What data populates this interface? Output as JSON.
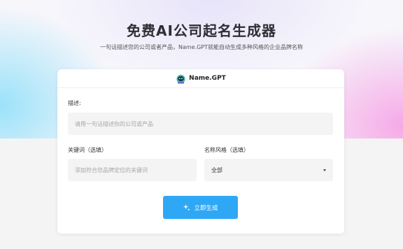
{
  "hero": {
    "title": "免费AI公司起名生成器",
    "subtitle": "一句话描述您的公司或者产品，Name.GPT就能自动生成多种风格的企业品牌名称"
  },
  "card": {
    "brand": "Name.GPT",
    "logo_icon": "robot-logo-icon",
    "description": {
      "label": "描述:",
      "placeholder": "请用一句话描述你的公司或产品",
      "value": ""
    },
    "keywords": {
      "label": "关键词（选填）",
      "placeholder": "添加符合您品牌定位的关键词",
      "value": ""
    },
    "style": {
      "label": "名称风格（选填）",
      "selected": "全部"
    },
    "generate_button": {
      "label": "立即生成",
      "icon": "sparkle-icon"
    }
  },
  "colors": {
    "accent": "#2ea8f5",
    "hero_left": "#96e1fa",
    "hero_right": "#f5a5e6"
  }
}
